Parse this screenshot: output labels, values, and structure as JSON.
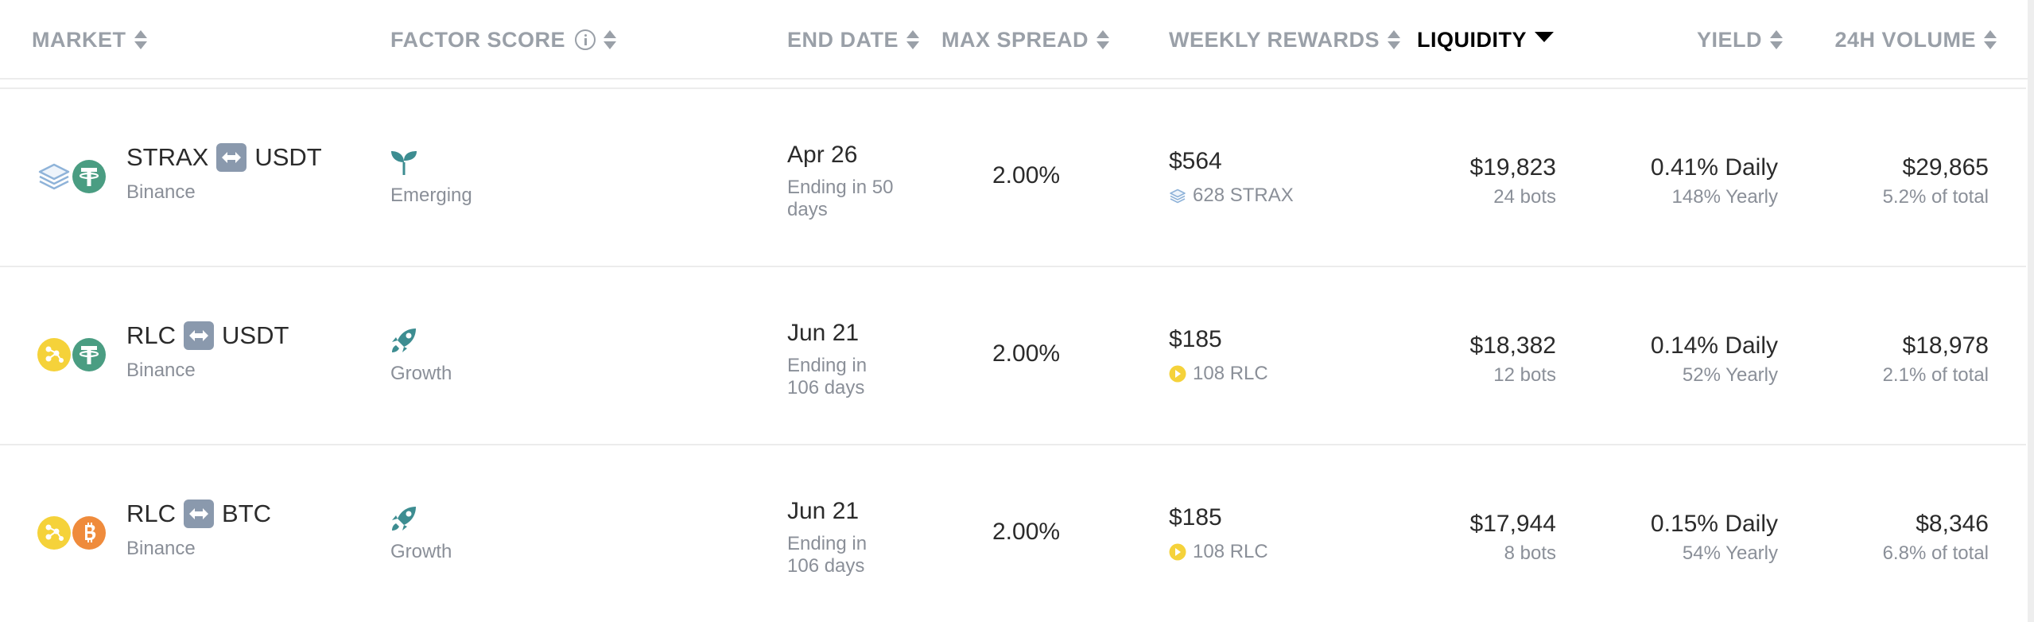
{
  "header": {
    "market": "MARKET",
    "factor_score": "FACTOR SCORE",
    "end_date": "END DATE",
    "max_spread": "MAX SPREAD",
    "weekly_rewards": "WEEKLY REWARDS",
    "liquidity": "LIQUIDITY",
    "yield": "YIELD",
    "volume_24h": "24H VOLUME"
  },
  "colors": {
    "header_text": "#9aa0a8",
    "active_header": "#000000",
    "tether_green": "#4a9d82",
    "rlc_yellow": "#f5d23a",
    "btc_orange": "#ef8b3c",
    "strax_blue": "#8fb3d9",
    "factor_teal": "#3d8d91"
  },
  "rows": [
    {
      "base": "STRAX",
      "quote": "USDT",
      "base_icon": "strax-icon",
      "quote_icon": "tether-icon",
      "exchange": "Binance",
      "factor_icon": "sprout-icon",
      "factor_label": "Emerging",
      "end_date": "Apr 26",
      "ending_in": "Ending in 50 days",
      "max_spread": "2.00%",
      "reward_usd": "$564",
      "reward_token_icon": "strax-icon",
      "reward_token": "628 STRAX",
      "liquidity": "$19,823",
      "bots": "24 bots",
      "yield_daily": "0.41% Daily",
      "yield_yearly": "148% Yearly",
      "volume": "$29,865",
      "volume_share": "5.2% of total"
    },
    {
      "base": "RLC",
      "quote": "USDT",
      "base_icon": "rlc-icon",
      "quote_icon": "tether-icon",
      "exchange": "Binance",
      "factor_icon": "rocket-icon",
      "factor_label": "Growth",
      "end_date": "Jun 21",
      "ending_in": "Ending in 106 days",
      "max_spread": "2.00%",
      "reward_usd": "$185",
      "reward_token_icon": "rlc-icon",
      "reward_token": "108 RLC",
      "liquidity": "$18,382",
      "bots": "12 bots",
      "yield_daily": "0.14% Daily",
      "yield_yearly": "52% Yearly",
      "volume": "$18,978",
      "volume_share": "2.1% of total"
    },
    {
      "base": "RLC",
      "quote": "BTC",
      "base_icon": "rlc-icon",
      "quote_icon": "bitcoin-icon",
      "exchange": "Binance",
      "factor_icon": "rocket-icon",
      "factor_label": "Growth",
      "end_date": "Jun 21",
      "ending_in": "Ending in 106 days",
      "max_spread": "2.00%",
      "reward_usd": "$185",
      "reward_token_icon": "rlc-icon",
      "reward_token": "108 RLC",
      "liquidity": "$17,944",
      "bots": "8 bots",
      "yield_daily": "0.15% Daily",
      "yield_yearly": "54% Yearly",
      "volume": "$8,346",
      "volume_share": "6.8% of total"
    }
  ]
}
